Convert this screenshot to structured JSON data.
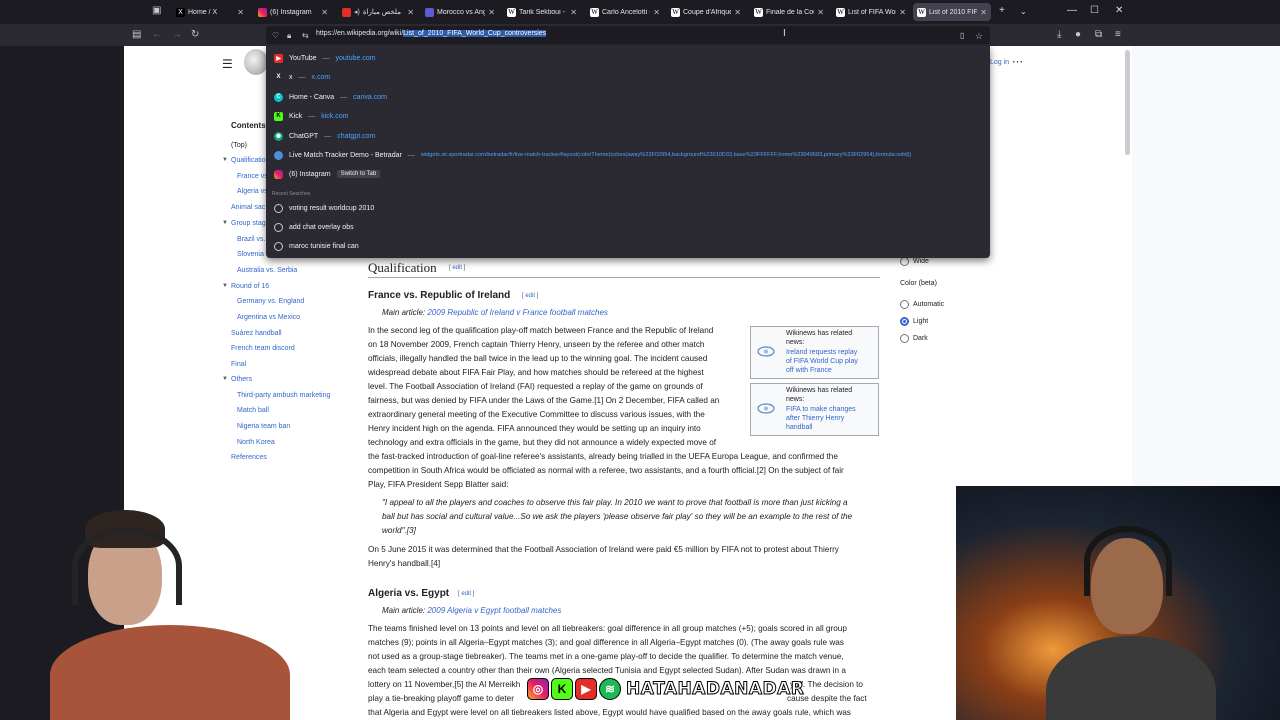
{
  "tabs": [
    {
      "label": "Home / X",
      "icon": "x-icon"
    },
    {
      "label": "(6) Instagram",
      "icon": "instagram-icon"
    },
    {
      "label": "ملخص مباراة",
      "icon": "youtube-icon"
    },
    {
      "label": "Morocco vs Ang",
      "icon": "wiki-icon"
    },
    {
      "label": "Tarik Sektioui - Wi",
      "icon": "wikipedia-icon"
    },
    {
      "label": "Carlo Ancelotti - V",
      "icon": "wikipedia-icon"
    },
    {
      "label": "Coupe d'Afrique",
      "icon": "wikipedia-icon"
    },
    {
      "label": "Finale de la Coup",
      "icon": "wikipedia-icon"
    },
    {
      "label": "List of FIFA Worl",
      "icon": "wikipedia-icon"
    },
    {
      "label": "List of 2010 FIFA",
      "icon": "wikipedia-icon"
    }
  ],
  "colors": {
    "accent": "#3366cc",
    "chrome_dark": "#1c1b22",
    "chrome": "#2b2a33",
    "link_blue": "#4aa3ff"
  },
  "url": {
    "prefix": "https://en.wikipedia.org/wiki/",
    "selected": "List_of_2010_FIFA_World_Cup_controversies"
  },
  "suggestions": [
    {
      "title": "YouTube",
      "host": "youtube.com",
      "icon": "youtube-icon"
    },
    {
      "title": "x",
      "host": "x.com",
      "icon": "x-icon"
    },
    {
      "title": "Home - Canva",
      "host": "canva.com",
      "icon": "canva-icon"
    },
    {
      "title": "Kick",
      "host": "kick.com",
      "icon": "kick-icon"
    },
    {
      "title": "ChatGPT",
      "host": "chatgpt.com",
      "icon": "chatgpt-icon"
    },
    {
      "title": "Live Match Tracker Demo - Betradar",
      "host": "widgets.sir.sportradar.com/betradar/fr/live-match-tracker#layout(colorTheme(colors(away%23F02954,background%23010D33,base%23FFFFFF,home%23049583,primary%23F02954),formula:solid))",
      "icon": "globe-icon"
    },
    {
      "title": "(6) Instagram",
      "action": "Switch to Tab",
      "icon": "instagram-icon"
    }
  ],
  "recent_header": "Recent Searches",
  "recent_searches": [
    "voting result worldcup 2010",
    "add chat overlay obs",
    "maroc tunisie final can"
  ],
  "sidebar": {
    "login": "Log in",
    "toc_title": "Contents",
    "toc": [
      "(Top)",
      "Qualification",
      "France vs. R",
      "Algeria vs. E",
      "Animal sac",
      "Group stage",
      "Brazil vs.",
      "Slovenia",
      "Australia vs. Serbia",
      "Round of 16",
      "Germany vs. England",
      "Argentina vs Mexico",
      "Suárez handball",
      "French team discord",
      "Final",
      "Others",
      "Third-party ambush marketing",
      "Match ball",
      "Nigeria team ban",
      "North Korea",
      "References"
    ]
  },
  "appearance": {
    "width_option": "Wide",
    "color_heading": "Color (beta)",
    "color_options": [
      "Automatic",
      "Light",
      "Dark"
    ],
    "selected_color": "Light"
  },
  "article": {
    "edit": "edit",
    "section": "Qualification",
    "sub1": {
      "title": "France vs. Republic of Ireland",
      "main_prefix": "Main article:",
      "main_link": "2009 Republic of Ireland v France football matches",
      "p1": [
        "In the second leg of the qualification play-off match between France and the Republic of Ireland",
        "on 18 November 2009, French captain Thierry Henry, unseen by the referee and other match",
        "officials, illegally handled the ball twice in the lead up to the winning goal. The incident caused",
        "widespread debate about FIFA Fair Play, and how matches should be refereed at the highest",
        "level. The Football Association of Ireland (FAI) requested a replay of the game on grounds of",
        "fairness, but was denied by FIFA under the Laws of the Game.[1] On 2 December, FIFA called an",
        "extraordinary general meeting of the Executive Committee to discuss various issues, with the",
        "Henry incident high on the agenda. FIFA announced they would be setting up an inquiry into",
        "technology and extra officials in the game, but they did not announce a widely expected move of",
        "the fast-tracked introduction of goal-line referee's assistants, already being trialled in the UEFA Europa League, and confirmed the",
        "competition in South Africa would be officiated as normal with a referee, two assistants, and a fourth official.[2] On the subject of fair",
        "Play, FIFA President Sepp Blatter said:"
      ],
      "quote": [
        "\"I appeal to all the players and coaches to observe this fair play. In 2010 we want to prove that football is more than just kicking a",
        "ball but has social and cultural value...So we ask the players 'please observe fair play' so they will be an example to the rest of the",
        "world\".[3]"
      ],
      "p2": [
        "On 5 June 2015 it was determined that the Football Association of Ireland were paid €5 million by FIFA not to protest about Thierry",
        "Henry's handball.[4]"
      ]
    },
    "news1": {
      "header": [
        "Wikinews has related",
        "news:"
      ],
      "link": [
        "Ireland requests replay",
        "of FIFA World Cup play",
        "off with France"
      ]
    },
    "news2": {
      "header": [
        "Wikinews has related",
        "news:"
      ],
      "link": [
        "FIFA to make changes",
        "after Thierry Henry",
        "handball"
      ]
    },
    "sub2": {
      "title": "Algeria vs. Egypt",
      "main_prefix": "Main article:",
      "main_link": "2009 Algeria v Egypt football matches",
      "p1": [
        "The teams finished level on 13 points and level on all tiebreakers: goal difference in all group matches (+5); goals scored in all group",
        "matches (9); points in all Algeria–Egypt matches (3); and goal difference in all Algeria–Egypt matches (0). (The away goals rule was",
        "not used as a group-stage tiebreaker). The teams met in a one-game play-off to decide the qualifier. To determine the match venue,",
        "each team selected a country other than their own (Algeria selected Tunisia and Egypt selected Sudan). After Sudan was drawn in a",
        "lottery on 11 November,[5] the Al Merreikh",
        "play a tie-breaking playoff game to deter",
        "that Algeria and Egypt were level on all tiebreakers listed above, Egypt would have qualified based on the away goals rule, which was"
      ],
      "p1_tail1": "yoff. The decision to",
      "p1_tail2": "cause despite the fact"
    }
  },
  "overlay": {
    "handle": "HATAHADANADAR",
    "social_icons": [
      "instagram-icon",
      "kick-icon",
      "youtube-icon",
      "spotify-icon"
    ]
  }
}
